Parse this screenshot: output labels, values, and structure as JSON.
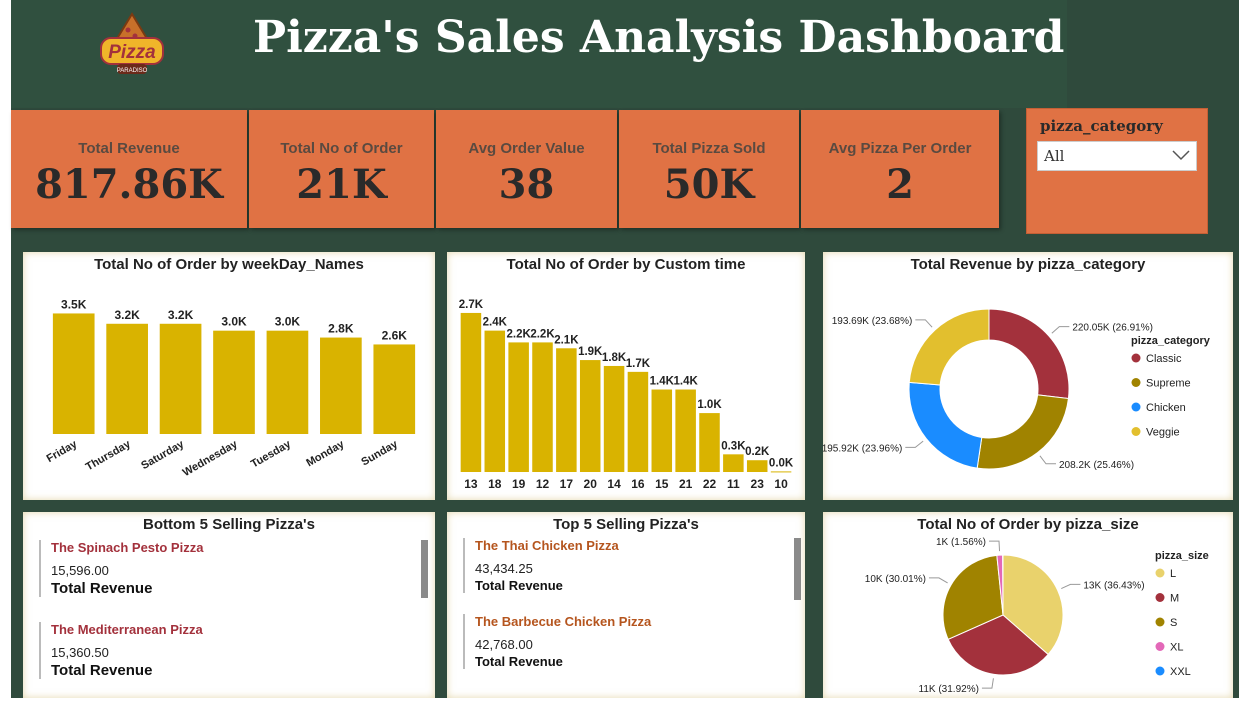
{
  "header": {
    "title": "Pizza's Sales Analysis Dashboard",
    "logo_text": "Pizza",
    "logo_sub": "PARADISO"
  },
  "kpis": [
    {
      "label": "Total Revenue",
      "value": "817.86K"
    },
    {
      "label": "Total No of Order",
      "value": "21K"
    },
    {
      "label": "Avg Order Value",
      "value": "38"
    },
    {
      "label": "Total Pizza Sold",
      "value": "50K"
    },
    {
      "label": "Avg Pizza Per Order",
      "value": "2"
    }
  ],
  "slicer": {
    "label": "pizza_category",
    "value": "All"
  },
  "colors": {
    "bar": "#d9b300",
    "kpi": "#e07244",
    "background": "#2f4a3c",
    "classic": "#a3313c",
    "supreme": "#a08300",
    "chicken": "#1a8cff",
    "veggie": "#e2bf2e",
    "size_L": "#e9d26c",
    "size_M": "#a3313c",
    "size_S": "#a08300",
    "size_XL": "#e368b8",
    "size_XXL": "#1a8cff"
  },
  "chart_data": [
    {
      "type": "bar",
      "title": "Total No of Order by weekDay_Names",
      "categories": [
        "Friday",
        "Thursday",
        "Saturday",
        "Wednesday",
        "Tuesday",
        "Monday",
        "Sunday"
      ],
      "values": [
        3500,
        3200,
        3200,
        3000,
        3000,
        2800,
        2600
      ],
      "labels": [
        "3.5K",
        "3.2K",
        "3.2K",
        "3.0K",
        "3.0K",
        "2.8K",
        "2.6K"
      ],
      "ylim": [
        0,
        3600
      ]
    },
    {
      "type": "bar",
      "title": "Total No of Order by Custom time",
      "categories": [
        "13",
        "18",
        "19",
        "12",
        "17",
        "20",
        "14",
        "16",
        "15",
        "21",
        "22",
        "11",
        "23",
        "10"
      ],
      "values": [
        2700,
        2400,
        2200,
        2200,
        2100,
        1900,
        1800,
        1700,
        1400,
        1400,
        1000,
        300,
        200,
        10
      ],
      "labels": [
        "2.7K",
        "2.4K",
        "2.2K",
        "2.2K",
        "2.1K",
        "1.9K",
        "1.8K",
        "1.7K",
        "1.4K",
        "1.4K",
        "1.0K",
        "0.3K",
        "0.2K",
        "0.0K"
      ],
      "ylim": [
        0,
        2750
      ]
    },
    {
      "type": "pie",
      "title": "Total Revenue by pizza_category",
      "legend_title": "pizza_category",
      "legend": "right",
      "categories": [
        "Classic",
        "Supreme",
        "Chicken",
        "Veggie"
      ],
      "values": [
        220050,
        208200,
        195920,
        193690
      ],
      "labels": [
        "220.05K (26.91%)",
        "208.2K (25.46%)",
        "195.92K (23.96%)",
        "193.69K (23.68%)"
      ],
      "colors": [
        "#a3313c",
        "#a08300",
        "#1a8cff",
        "#e2bf2e"
      ]
    },
    {
      "type": "pie",
      "title": "Total No of Order by pizza_size",
      "legend_title": "pizza_size",
      "legend": "right",
      "categories": [
        "L",
        "M",
        "S",
        "XL",
        "XXL"
      ],
      "values": [
        36.43,
        31.92,
        30.01,
        1.56,
        0.08
      ],
      "labels": [
        "13K (36.43%)",
        "11K (31.92%)",
        "10K (30.01%)",
        "1K (1.56%)",
        ""
      ],
      "colors": [
        "#e9d26c",
        "#a3313c",
        "#a08300",
        "#e368b8",
        "#1a8cff"
      ]
    }
  ],
  "bottom5": {
    "title": "Bottom 5 Selling Pizza's",
    "items": [
      {
        "name": "The Spinach Pesto Pizza",
        "value": "15,596.00",
        "sub": "Total Revenue"
      },
      {
        "name": "The Mediterranean Pizza",
        "value": "15,360.50",
        "sub": "Total Revenue"
      }
    ]
  },
  "top5": {
    "title": "Top 5 Selling Pizza's",
    "items": [
      {
        "name": "The Thai Chicken Pizza",
        "value": "43,434.25",
        "sub": "Total Revenue"
      },
      {
        "name": "The Barbecue Chicken Pizza",
        "value": "42,768.00",
        "sub": "Total Revenue"
      }
    ]
  }
}
